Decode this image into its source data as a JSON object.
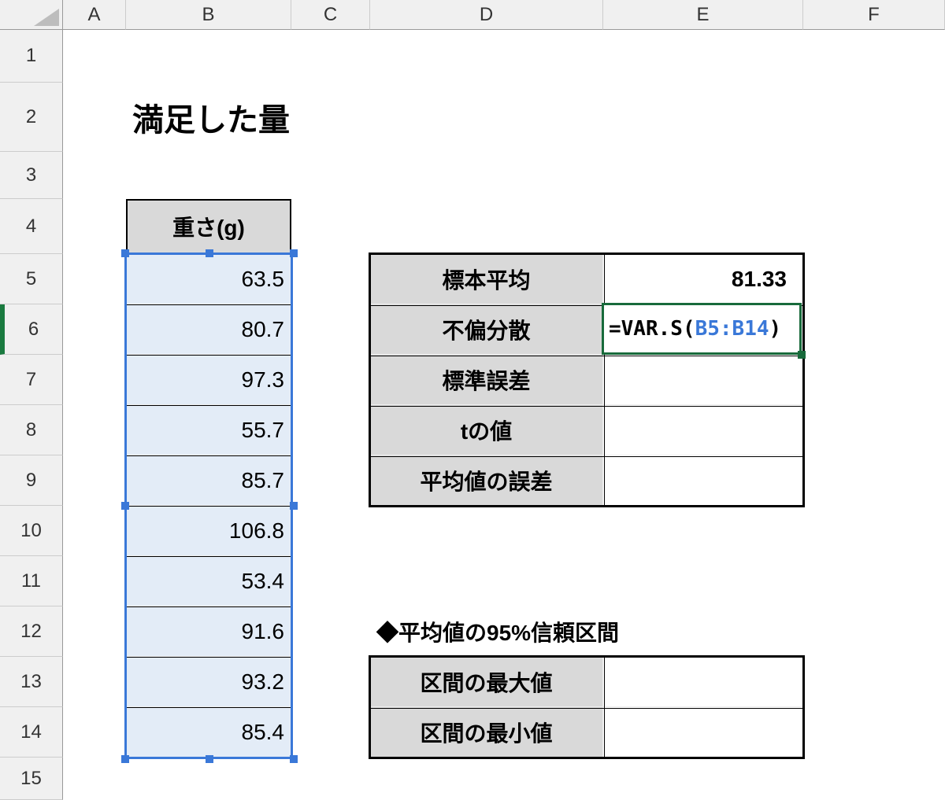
{
  "columns": [
    "A",
    "B",
    "C",
    "D",
    "E",
    "F"
  ],
  "rows": [
    "1",
    "2",
    "3",
    "4",
    "5",
    "6",
    "7",
    "8",
    "9",
    "10",
    "11",
    "12",
    "13",
    "14",
    "15"
  ],
  "title": "満足した量",
  "dataHeader": "重さ(g)",
  "dataValues": [
    "63.5",
    "80.7",
    "97.3",
    "55.7",
    "85.7",
    "106.8",
    "53.4",
    "91.6",
    "93.2",
    "85.4"
  ],
  "stats": {
    "r5_label": "標本平均",
    "r5_val": "81.33",
    "r6_label": "不偏分散",
    "r7_label": "標準誤差",
    "r8_label": "tの値",
    "r9_label": "平均値の誤差"
  },
  "formula": {
    "eq": "=",
    "func": "VAR.S",
    "open": "(",
    "ref": "B5:B14",
    "close": ")"
  },
  "sectionHeading": "◆平均値の95%信頼区間",
  "interval": {
    "max_label": "区間の最大値",
    "min_label": "区間の最小値"
  },
  "activeRow": "6"
}
